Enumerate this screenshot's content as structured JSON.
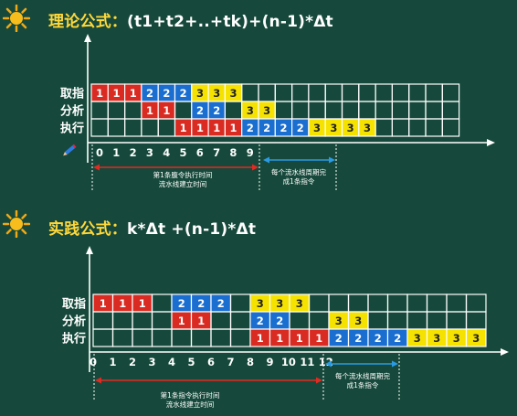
{
  "sections": [
    {
      "heading": "理论公式：",
      "formula": "(t1+t2+..+tk)+(n-1)*Δt",
      "row_labels": [
        "取指",
        "分析",
        "执行"
      ],
      "axis_ticks": [
        "0",
        "1",
        "2",
        "3",
        "4",
        "5",
        "6",
        "7",
        "8",
        "9"
      ],
      "rows": [
        [
          1,
          1,
          1,
          2,
          2,
          2,
          3,
          3,
          3,
          0,
          0,
          0,
          0,
          0,
          0,
          0,
          0,
          0,
          0,
          0,
          0,
          0
        ],
        [
          0,
          0,
          0,
          1,
          1,
          0,
          2,
          2,
          0,
          3,
          3,
          0,
          0,
          0,
          0,
          0,
          0,
          0,
          0,
          0,
          0,
          0
        ],
        [
          0,
          0,
          0,
          0,
          0,
          1,
          1,
          1,
          1,
          2,
          2,
          2,
          2,
          3,
          3,
          3,
          3,
          0,
          0,
          0,
          0,
          0
        ]
      ],
      "annotation_left": [
        "第1条腹令执行时间",
        "流水线建立时间"
      ],
      "annotation_right": [
        "每个流水线周期完",
        "成1条指令"
      ]
    },
    {
      "heading": "实践公式：",
      "formula": "k*Δt +(n-1)*Δt",
      "row_labels": [
        "取指",
        "分析",
        "执行"
      ],
      "axis_ticks": [
        "0",
        "1",
        "2",
        "3",
        "4",
        "5",
        "6",
        "7",
        "8",
        "9",
        "10",
        "11",
        "12"
      ],
      "rows": [
        [
          1,
          1,
          1,
          0,
          2,
          2,
          2,
          0,
          3,
          3,
          3,
          0,
          0,
          0,
          0,
          0,
          0,
          0,
          0,
          0
        ],
        [
          0,
          0,
          0,
          0,
          1,
          1,
          0,
          0,
          2,
          2,
          0,
          0,
          3,
          3,
          0,
          0,
          0,
          0,
          0,
          0
        ],
        [
          0,
          0,
          0,
          0,
          0,
          0,
          0,
          0,
          1,
          1,
          1,
          1,
          2,
          2,
          2,
          2,
          3,
          3,
          3,
          3
        ]
      ],
      "annotation_left": [
        "第1条指令执行时间",
        "流水线建立时间"
      ],
      "annotation_right": [
        "每个流水线周期完",
        "成1条指令"
      ]
    }
  ],
  "colors": {
    "background": "#16493b",
    "title": "#ffd83a",
    "instr1": "#d92b22",
    "instr2": "#1a6ed0",
    "instr3": "#f6e200",
    "axis": "#ffffff",
    "arrow_red": "#e02a22",
    "arrow_blue": "#2a9be3"
  },
  "icons": [
    "sun-icon",
    "pencil-icon"
  ]
}
